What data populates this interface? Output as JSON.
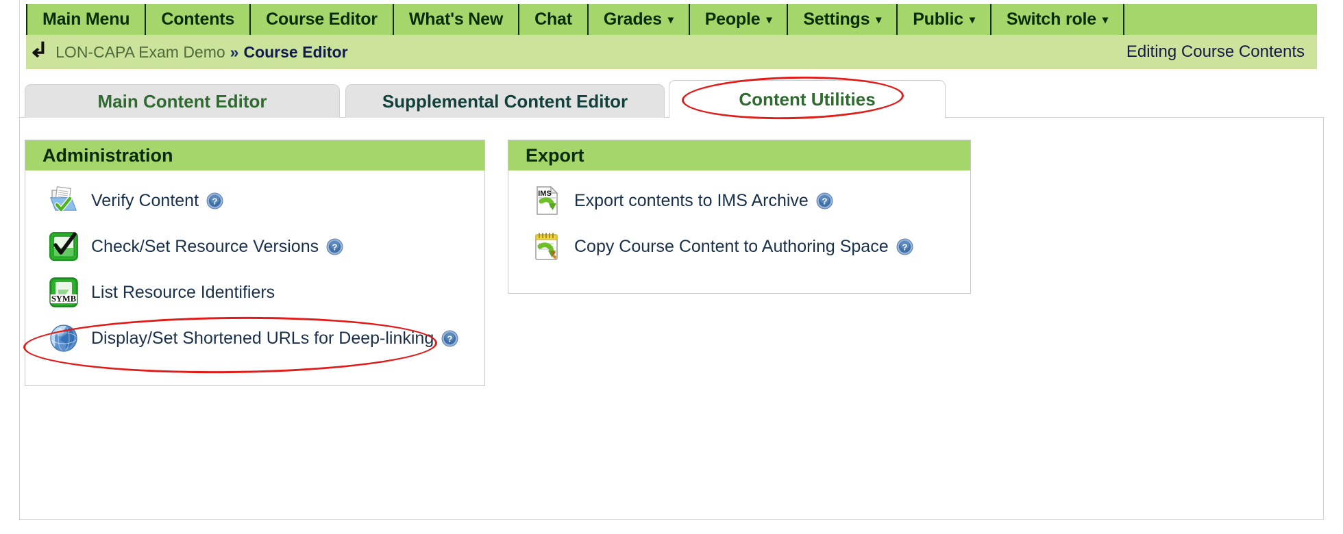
{
  "nav": {
    "items": [
      {
        "label": "Main Menu",
        "has_caret": false,
        "name": "nav-main-menu"
      },
      {
        "label": "Contents",
        "has_caret": false,
        "name": "nav-contents"
      },
      {
        "label": "Course Editor",
        "has_caret": false,
        "name": "nav-course-editor"
      },
      {
        "label": "What's New",
        "has_caret": false,
        "name": "nav-whats-new"
      },
      {
        "label": "Chat",
        "has_caret": false,
        "name": "nav-chat"
      },
      {
        "label": "Grades",
        "has_caret": true,
        "name": "nav-grades"
      },
      {
        "label": "People",
        "has_caret": true,
        "name": "nav-people"
      },
      {
        "label": "Settings",
        "has_caret": true,
        "name": "nav-settings"
      },
      {
        "label": "Public",
        "has_caret": true,
        "name": "nav-public"
      },
      {
        "label": "Switch role",
        "has_caret": true,
        "name": "nav-switch-role"
      }
    ],
    "caret_glyph": "▾"
  },
  "breadcrumb": {
    "back_arrow": "⤶",
    "course": "LON-CAPA Exam Demo",
    "separator": "»",
    "current": "Course Editor",
    "status": "Editing Course Contents"
  },
  "tabs": [
    {
      "label": "Main Content Editor",
      "active": false
    },
    {
      "label": "Supplemental Content Editor",
      "active": false
    },
    {
      "label": "Content Utilities",
      "active": true
    }
  ],
  "panels": {
    "administration": {
      "title": "Administration",
      "rows": [
        {
          "label": "Verify Content",
          "icon": "verify-content-icon",
          "help": true
        },
        {
          "label": "Check/Set Resource Versions",
          "icon": "check-set-versions-icon",
          "help": true
        },
        {
          "label": "List Resource Identifiers",
          "icon": "symb-icon",
          "help": false
        },
        {
          "label": "Display/Set Shortened URLs for Deep-linking",
          "icon": "globe-icon",
          "help": true
        }
      ]
    },
    "export": {
      "title": "Export",
      "rows": [
        {
          "label": "Export contents to IMS Archive",
          "icon": "ims-archive-icon",
          "help": true
        },
        {
          "label": "Copy Course Content to Authoring Space",
          "icon": "copy-authoring-space-icon",
          "help": true
        }
      ]
    }
  },
  "annotations": [
    {
      "target": "Content Utilities",
      "shape": "ellipse",
      "color": "#e01b18"
    },
    {
      "target": "Display/Set Shortened URLs for Deep-linking",
      "shape": "ellipse",
      "color": "#e01b18"
    }
  ],
  "colors": {
    "nav_green": "#a5d66c",
    "crumb_green": "#cbe39b",
    "panel_header_green": "#a5d66c",
    "tab_inactive": "#e3e3e3",
    "annotation_red": "#e01b18",
    "link_text": "#19304a"
  }
}
